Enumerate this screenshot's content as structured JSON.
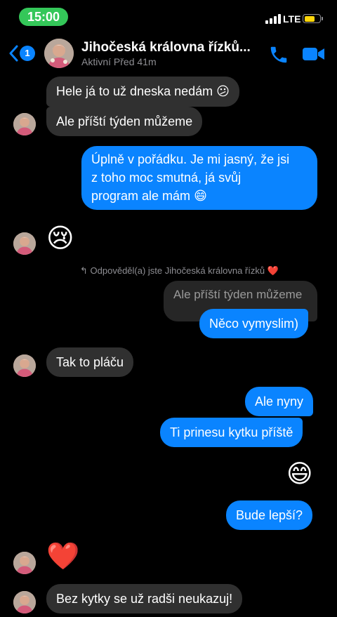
{
  "status_bar": {
    "time": "15:00",
    "network": "LTE",
    "battery_color": "#ffd60a",
    "time_pill_color": "#34c759"
  },
  "header": {
    "back_badge": "1",
    "contact_name": "Jihočeská královna řízků...",
    "status": "Aktivní Před 41m",
    "icons": [
      "back-chevron-icon",
      "phone-icon",
      "video-camera-icon"
    ],
    "accent": "#0a84ff"
  },
  "messages": [
    {
      "from": "them",
      "text": "Hele já to už dneska nedám",
      "emoji": "😕"
    },
    {
      "from": "them",
      "text": "Ale příští týden můžeme"
    },
    {
      "from": "me",
      "lines": [
        "Úplně v pořádku. Je mi jasný, že jsi",
        "z toho moc smutná, já svůj",
        "program ale mám"
      ],
      "emoji": "😄"
    },
    {
      "from": "them",
      "emoji": "😢"
    },
    {
      "from": "me",
      "reply_label": "Odpověděl(a) jste Jihočeská královna řízků",
      "reply_emoji": "❤️",
      "quoted": "Ale příští týden můžeme",
      "text": "Něco vymyslim)"
    },
    {
      "from": "them",
      "text": "Tak to pláču"
    },
    {
      "from": "me",
      "text": "Ale nyny"
    },
    {
      "from": "me",
      "text": "Ti prinesu kytku příště"
    },
    {
      "from": "me",
      "emoji": "😄"
    },
    {
      "from": "me",
      "text": "Bude lepší?"
    },
    {
      "from": "them",
      "emoji": "❤️"
    },
    {
      "from": "them",
      "text": "Bez kytky se už radši neukazuj!"
    }
  ],
  "colors": {
    "incoming_bubble": "#303030",
    "outgoing_bubble": "#0a84ff",
    "background": "#000000"
  }
}
